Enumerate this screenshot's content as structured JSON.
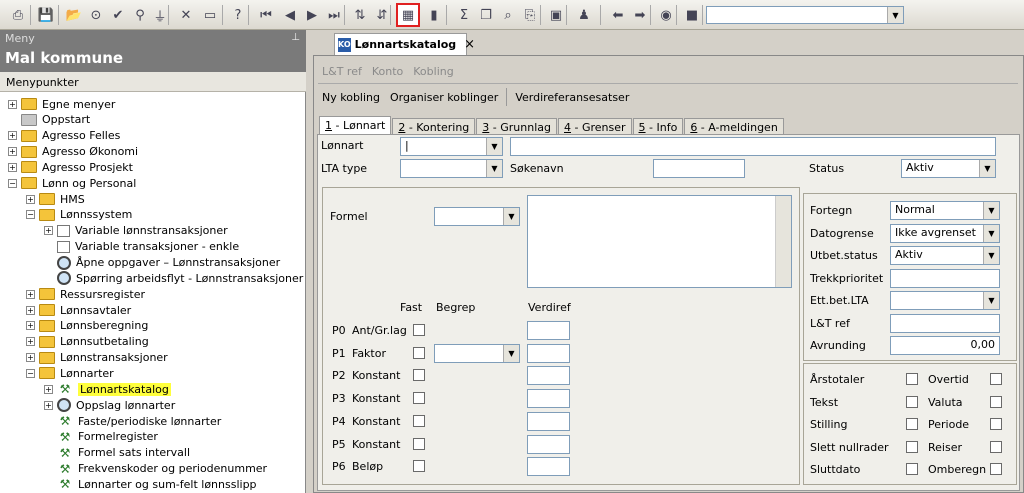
{
  "toolbar": {
    "icons": [
      "print-icon",
      "save-icon",
      "open-folder-icon",
      "binoculars-icon",
      "check-icon",
      "search-icon",
      "filter-icon",
      "delete-icon",
      "new-row-icon",
      "help-icon",
      "first-record-icon",
      "prev-record-icon",
      "next-record-icon",
      "last-record-icon",
      "sort-asc-icon",
      "sort-desc-icon",
      "table-view-icon",
      "chart-icon",
      "sum-icon",
      "copy-icon",
      "zoom-icon",
      "print-preview-icon",
      "screen-icon",
      "people-icon",
      "back-icon",
      "forward-icon",
      "record-icon",
      "stop-icon"
    ],
    "combo_value": ""
  },
  "menu": {
    "header_small": "Meny",
    "title": "Mal kommune",
    "subheader": "Menypunkter",
    "items": [
      {
        "label": "Egne menyer"
      },
      {
        "label": "Oppstart"
      },
      {
        "label": "Agresso Felles"
      },
      {
        "label": "Agresso Økonomi"
      },
      {
        "label": "Agresso Prosjekt"
      },
      {
        "label": "Lønn og Personal"
      },
      {
        "label": "HMS"
      },
      {
        "label": "Lønnssystem"
      },
      {
        "label": "Variable lønnstransaksjoner"
      },
      {
        "label": "Variable transaksjoner - enkle"
      },
      {
        "label": "Åpne oppgaver – Lønnstransaksjoner"
      },
      {
        "label": "Spørring arbeidsflyt - Lønnstransaksjoner"
      },
      {
        "label": "Ressursregister"
      },
      {
        "label": "Lønnsavtaler"
      },
      {
        "label": "Lønnsberegning"
      },
      {
        "label": "Lønnsutbetaling"
      },
      {
        "label": "Lønnstransaksjoner"
      },
      {
        "label": "Lønnarter"
      },
      {
        "label": "Lønnartskatalog"
      },
      {
        "label": "Oppslag lønnarter"
      },
      {
        "label": "Faste/periodiske lønnarter"
      },
      {
        "label": "Formelregister"
      },
      {
        "label": "Formel sats intervall"
      },
      {
        "label": "Frekvenskoder og periodenummer"
      },
      {
        "label": "Lønnarter og sum-felt lønnsslipp"
      }
    ]
  },
  "doc_tab": {
    "icon_text": "KO",
    "title": "Lønnartskatalog",
    "close": "×"
  },
  "toolbar_row1": {
    "lt_ref": "L&T ref",
    "konto": "Konto",
    "kobling": "Kobling"
  },
  "toolbar_row2": {
    "ny_kobling": "Ny kobling",
    "organiser": "Organiser koblinger",
    "verdireferanse": "Verdireferansesatser"
  },
  "tabs": [
    {
      "num": "1",
      "label": " - Lønnart"
    },
    {
      "num": "2",
      "label": " - Kontering"
    },
    {
      "num": "3",
      "label": " - Grunnlag"
    },
    {
      "num": "4",
      "label": " - Grenser"
    },
    {
      "num": "5",
      "label": " - Info"
    },
    {
      "num": "6",
      "label": " - A-meldingen"
    }
  ],
  "form": {
    "lonnart_label": "Lønnart",
    "lonnart_value": "|",
    "lta_type_label": "LTA type",
    "sokenavn_label": "Søkenavn",
    "status_label": "Status",
    "status_value": "Aktiv",
    "formel_label": "Formel",
    "col_fast": "Fast",
    "col_begrep": "Begrep",
    "col_verdiref": "Verdiref",
    "params": [
      {
        "code": "P0",
        "label": "Ant/Gr.lag"
      },
      {
        "code": "P1",
        "label": "Faktor"
      },
      {
        "code": "P2",
        "label": "Konstant"
      },
      {
        "code": "P3",
        "label": "Konstant"
      },
      {
        "code": "P4",
        "label": "Konstant"
      },
      {
        "code": "P5",
        "label": "Konstant"
      },
      {
        "code": "P6",
        "label": "Beløp"
      }
    ],
    "right": {
      "fortegn_label": "Fortegn",
      "fortegn_value": "Normal",
      "datogrense_label": "Datogrense",
      "datogrense_value": "Ikke avgrenset",
      "utbet_label": "Utbet.status",
      "utbet_value": "Aktiv",
      "trekk_label": "Trekkprioritet",
      "ettbet_label": "Ett.bet.LTA",
      "ltref_label": "L&T ref",
      "avrunding_label": "Avrunding",
      "avrunding_value": "0,00"
    },
    "flags_left": [
      "Årstotaler",
      "Tekst",
      "Stilling",
      "Slett nullrader",
      "Sluttdato"
    ],
    "flags_right": [
      "Overtid",
      "Valuta",
      "Periode",
      "Reiser",
      "Omberegn"
    ]
  }
}
